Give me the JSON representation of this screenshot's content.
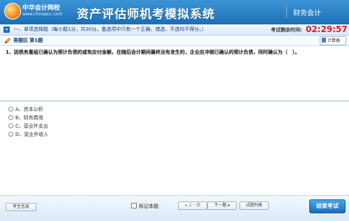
{
  "header": {
    "logo_name": "中华会计网校",
    "logo_url": "www.chinaacc.com",
    "title": "资产评估师机考模拟系统",
    "subject": "财务会计"
  },
  "section": {
    "toggle_glyph": "▾",
    "title": "一、单项选择题（每小题1分，共30分。备选项中只有一个正确，错选、不选均不得分。）",
    "timer_label": "考试剩余时间:",
    "timer_value": "02:29:57"
  },
  "answer_area": {
    "title": "答题区 第1题",
    "calculator_label": "计算器"
  },
  "question": {
    "text": "1、因债务重组已确认为预计负债的或有应付金额，在随后会计期间最终没有发生的，企业应冲销已确认的预计负债，同时确认为（　）。"
  },
  "options": [
    {
      "label": "A、资本公积"
    },
    {
      "label": "B、财务费用"
    },
    {
      "label": "C、营业外支出"
    },
    {
      "label": "D、营业外收入"
    }
  ],
  "footer": {
    "candidate_info": "考生信息",
    "mark_label": "标记本题",
    "prev": "◂ 上一题",
    "next": "下一题 ▸",
    "question_list": "试题列表",
    "submit": "结束考试"
  },
  "colors": {
    "header_bg": "#1c6fb5",
    "timer": "#e0181a",
    "submit_bg": "#1b6dbb"
  }
}
